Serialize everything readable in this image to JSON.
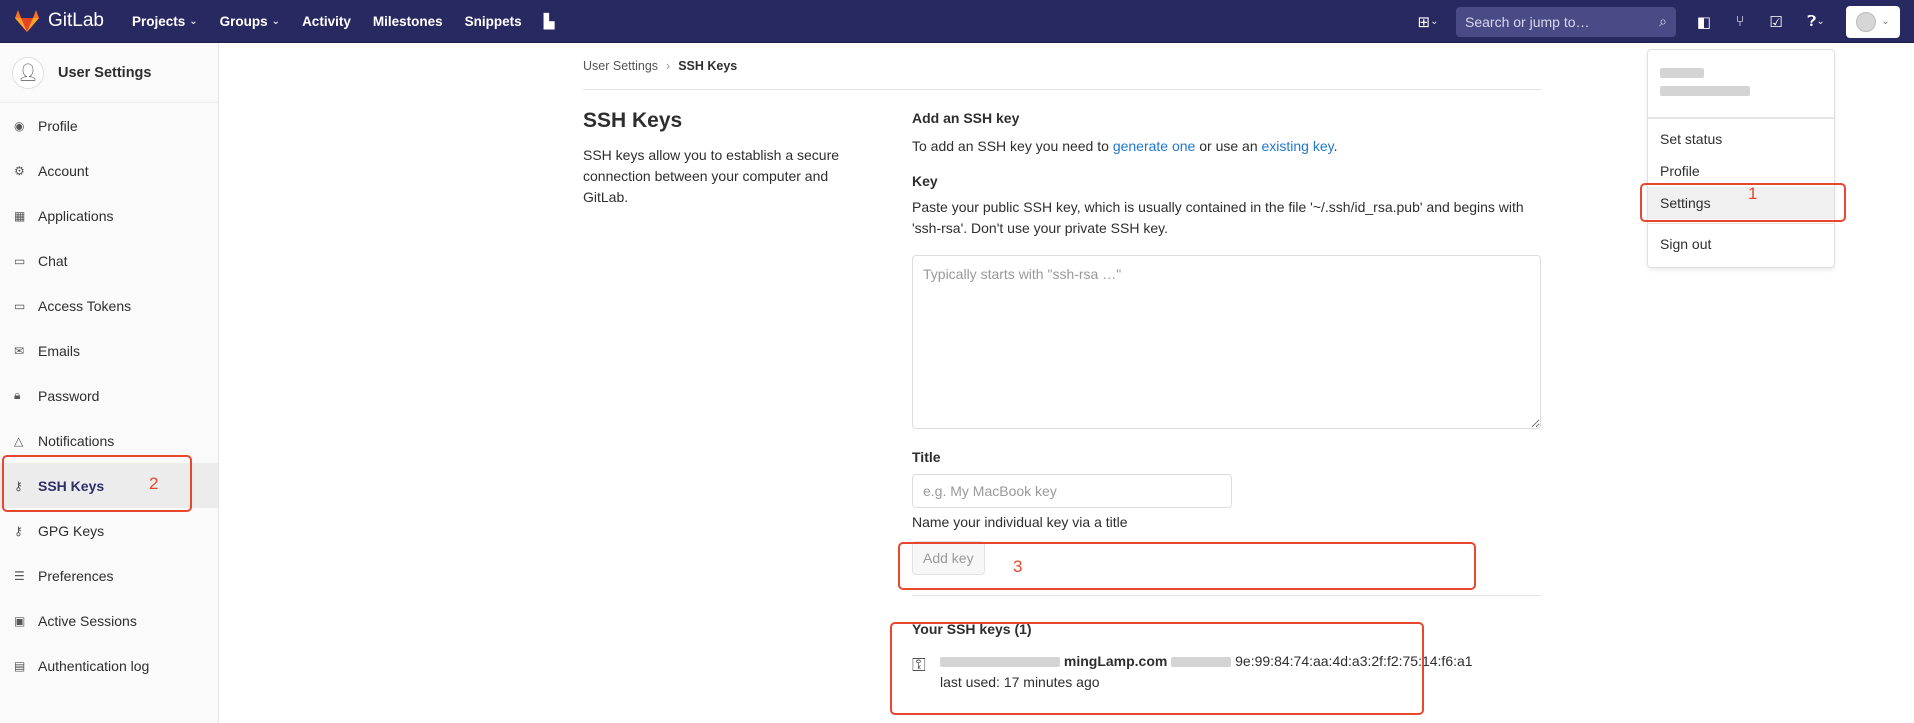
{
  "navbar": {
    "brand": "GitLab",
    "links": [
      "Projects",
      "Groups",
      "Activity",
      "Milestones",
      "Snippets"
    ],
    "search_placeholder": "Search or jump to…"
  },
  "sidebar": {
    "title": "User Settings",
    "items": [
      {
        "label": "Profile",
        "icon": "profile-icon",
        "glyph": "◉"
      },
      {
        "label": "Account",
        "icon": "account-icon",
        "glyph": "⚙"
      },
      {
        "label": "Applications",
        "icon": "applications-icon",
        "glyph": "▦"
      },
      {
        "label": "Chat",
        "icon": "chat-icon",
        "glyph": "▭"
      },
      {
        "label": "Access Tokens",
        "icon": "token-icon",
        "glyph": "▭"
      },
      {
        "label": "Emails",
        "icon": "email-icon",
        "glyph": "✉"
      },
      {
        "label": "Password",
        "icon": "lock-icon",
        "glyph": "🔒︎"
      },
      {
        "label": "Notifications",
        "icon": "bell-icon",
        "glyph": "△"
      },
      {
        "label": "SSH Keys",
        "icon": "key-icon",
        "glyph": "⚷",
        "active": true
      },
      {
        "label": "GPG Keys",
        "icon": "key-icon",
        "glyph": "⚷"
      },
      {
        "label": "Preferences",
        "icon": "sliders-icon",
        "glyph": "☰"
      },
      {
        "label": "Active Sessions",
        "icon": "monitor-icon",
        "glyph": "▣"
      },
      {
        "label": "Authentication log",
        "icon": "log-icon",
        "glyph": "▤"
      }
    ]
  },
  "breadcrumb": {
    "parent": "User Settings",
    "current": "SSH Keys"
  },
  "intro": {
    "heading": "SSH Keys",
    "description": "SSH keys allow you to establish a secure connection between your computer and GitLab."
  },
  "form": {
    "section_title": "Add an SSH key",
    "intro_prefix": "To add an SSH key you need to ",
    "generate_link": "generate one",
    "intro_middle": " or use an ",
    "existing_link": "existing key",
    "intro_suffix": ".",
    "key_label": "Key",
    "key_help": "Paste your public SSH key, which is usually contained in the file '~/.ssh/id_rsa.pub' and begins with 'ssh-rsa'. Don't use your private SSH key.",
    "key_placeholder": "Typically starts with \"ssh-rsa …\"",
    "title_label": "Title",
    "title_placeholder": "e.g. My MacBook key",
    "title_help": "Name your individual key via a title",
    "add_button": "Add key"
  },
  "keys": {
    "heading": "Your SSH keys (1)",
    "item": {
      "name_visible": "mingLamp.com",
      "fingerprint_visible": "9e:99:84:74:aa:4d:a3:2f:f2:75:14:f6:a1",
      "last_used": "last used: 17 minutes ago"
    }
  },
  "dropdown": {
    "items": [
      "Set status",
      "Profile",
      "Settings",
      "Sign out"
    ]
  },
  "annotations": {
    "one": "1",
    "two": "2",
    "three": "3"
  },
  "colors": {
    "navbar": "#292961",
    "accent_link": "#1f78d1",
    "annotation": "#e8472d"
  }
}
